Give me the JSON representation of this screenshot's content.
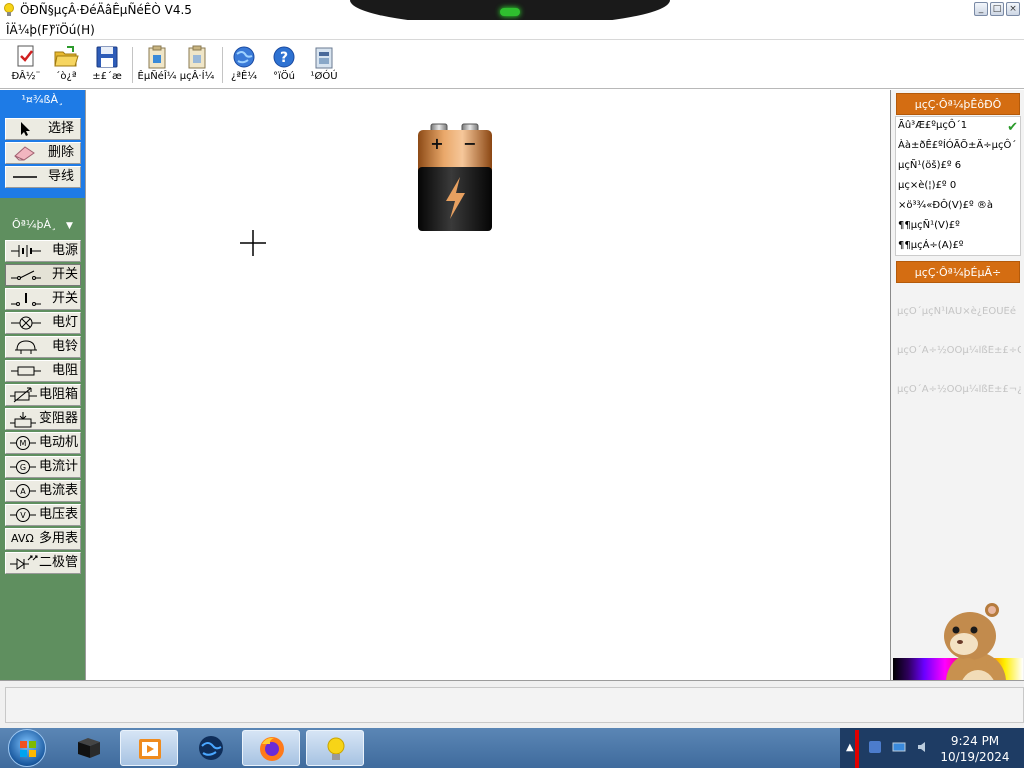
{
  "window": {
    "title": "ÖÐÑ§µçÂ·ÐéÄâÊµÑéÊÒ V4.5",
    "minimize": "_",
    "maximize": "□",
    "close": "×"
  },
  "menu": [
    "ÎÄ¼þ(F)",
    "°ïÖú(H)"
  ],
  "toolbar": [
    {
      "label": "ÐÂ½¨",
      "icon": "new-document-icon"
    },
    {
      "label": "´ò¿ª",
      "icon": "open-folder-icon"
    },
    {
      "label": "±£´æ",
      "icon": "save-disk-icon"
    },
    {
      "label": "ÊµÑéÎ¼",
      "icon": "experiment-list-icon"
    },
    {
      "label": "µçÂ·Í¼",
      "icon": "circuit-diagram-icon"
    },
    {
      "label": "¿ªÊ¼",
      "icon": "globe-icon"
    },
    {
      "label": "°ïÖú",
      "icon": "help-icon"
    },
    {
      "label": "¹ØÓÚ",
      "icon": "about-icon"
    }
  ],
  "tools": {
    "header": "¹¤¾ßÀ¸",
    "items": [
      {
        "label": "选择",
        "icon": "pointer-icon"
      },
      {
        "label": "删除",
        "icon": "eraser-icon"
      },
      {
        "label": "导线",
        "icon": "wire-icon"
      }
    ]
  },
  "components": {
    "header": "Ôª¼þÀ¸",
    "items": [
      {
        "label": "电源",
        "icon": "power-source-icon"
      },
      {
        "label": "开关",
        "icon": "switch-icon",
        "active": true
      },
      {
        "label": "开关",
        "icon": "spdt-switch-icon"
      },
      {
        "label": "电灯",
        "icon": "lamp-icon"
      },
      {
        "label": "电铃",
        "icon": "bell-icon"
      },
      {
        "label": "电阻",
        "icon": "resistor-icon"
      },
      {
        "label": "电阻箱",
        "icon": "resistance-box-icon"
      },
      {
        "label": "变阻器",
        "icon": "rheostat-icon"
      },
      {
        "label": "电动机",
        "icon": "motor-icon"
      },
      {
        "label": "电流计",
        "icon": "galvanometer-icon"
      },
      {
        "label": "电流表",
        "icon": "ammeter-icon"
      },
      {
        "label": "电压表",
        "icon": "voltmeter-icon"
      },
      {
        "label": "多用表",
        "icon": "multimeter-icon",
        "prefix": "AVΩ"
      },
      {
        "label": "二极管",
        "icon": "diode-icon"
      }
    ]
  },
  "properties": {
    "header": "µçÇ·Ôª¼þÊôÐÔ",
    "rows": [
      "Ãû³Æ£ºµçÔ´1",
      "Àà±ðÊ£ºÍÓÃÕ±Ä÷µçÔ´",
      "µçÑ¹(öš)£º 6",
      "µç×è(¦)£º   0",
      "×ö³¾«ÐÔ(V)£º ®à",
      "¶¶µçÑ¹(V)£º",
      "¶¶µçÁ÷(A)£º"
    ],
    "checked": true
  },
  "faults": {
    "header": "µçÇ·Ôª¼þÉµÃ÷",
    "rows": [
      "µçÔ´µçÑ¹ÍÄÛ×è¿ÉÖÜÊé",
      "µçÔ´Ä÷½ÓÕµ¼ÎßÊ±£÷ÕÛ",
      "µçÔ´Ä÷½ÓÕµ¼ÎßÊ±£¬¿Ê"
    ]
  },
  "statusbar": {
    "text": ""
  },
  "taskbar": {
    "time": "9:24 PM",
    "date": "10/19/2024"
  },
  "colors": {
    "accent_blue": "#1e7be6",
    "panel_green": "#5f8f5f",
    "property_orange": "#d46d12",
    "taskbar_blue": "#4a78a8"
  }
}
